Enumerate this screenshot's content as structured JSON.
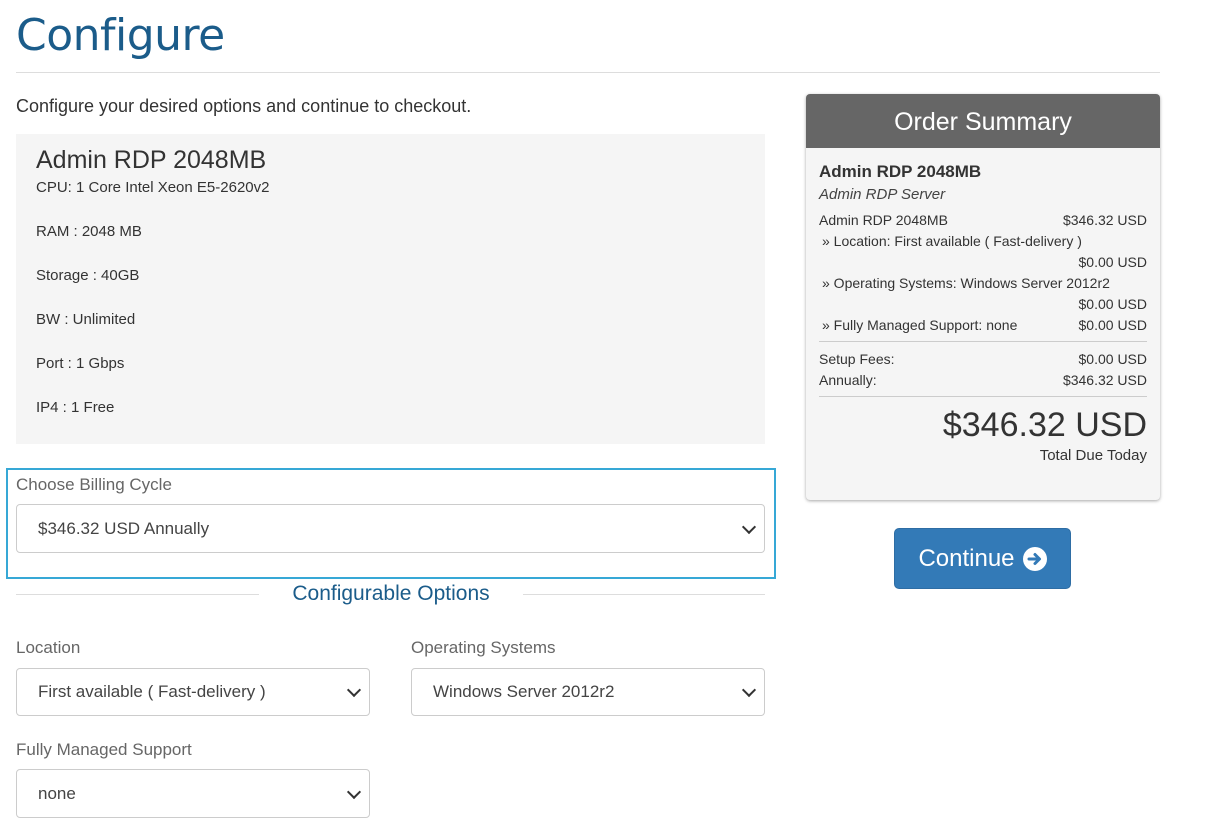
{
  "page": {
    "title": "Configure",
    "intro": "Configure your desired options and continue to checkout."
  },
  "product": {
    "name": "Admin RDP 2048MB",
    "specs": [
      "CPU: 1 Core Intel Xeon E5-2620v2",
      "RAM : 2048 MB",
      "Storage : 40GB",
      "BW : Unlimited",
      "Port : 1 Gbps",
      "IP4 : 1 Free"
    ]
  },
  "billing": {
    "label": "Choose Billing Cycle",
    "selected": "$346.32 USD Annually"
  },
  "configurable": {
    "heading": "Configurable Options",
    "location": {
      "label": "Location",
      "selected": "First available ( Fast-delivery )"
    },
    "os": {
      "label": "Operating Systems",
      "selected": "Windows Server 2012r2"
    },
    "support": {
      "label": "Fully Managed Support",
      "selected": "none"
    }
  },
  "summary": {
    "heading": "Order Summary",
    "product_name": "Admin RDP 2048MB",
    "product_group": "Admin RDP Server",
    "base_label": "Admin RDP 2048MB",
    "base_price": "$346.32 USD",
    "location_label": "» Location: First available ( Fast-delivery )",
    "location_price": "$0.00 USD",
    "os_label": "» Operating Systems: Windows Server 2012r2",
    "os_price": "$0.00 USD",
    "support_label": "» Fully Managed Support: none",
    "support_price": "$0.00 USD",
    "setup_label": "Setup Fees:",
    "setup_price": "$0.00 USD",
    "recurring_label": "Annually:",
    "recurring_price": "$346.32 USD",
    "total": "$346.32 USD",
    "total_label": "Total Due Today"
  },
  "actions": {
    "continue_label": "Continue",
    "continue_icon": "arrow-circle-right-icon"
  },
  "colors": {
    "title": "#1b5c8a",
    "accent_border": "#36a8d6",
    "summary_header": "#666666",
    "button": "#337ab7"
  }
}
